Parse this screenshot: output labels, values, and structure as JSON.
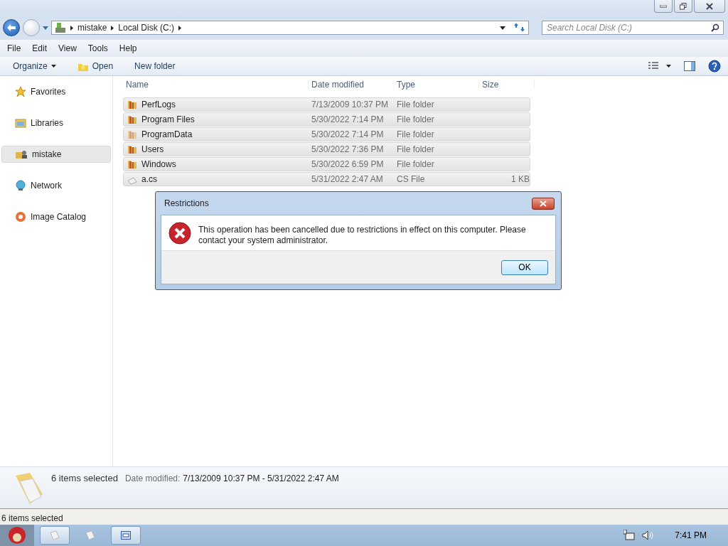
{
  "breadcrumb": [
    "mistake",
    "Local Disk (C:)"
  ],
  "search": {
    "placeholder": "Search Local Disk (C:)"
  },
  "menu": [
    "File",
    "Edit",
    "View",
    "Tools",
    "Help"
  ],
  "toolbar": {
    "organize": "Organize",
    "open": "Open",
    "new_folder": "New folder"
  },
  "sidebar": {
    "items": [
      {
        "label": "Favorites",
        "kind": "star",
        "selected": false
      },
      {
        "label": "Libraries",
        "kind": "library",
        "selected": false
      },
      {
        "label": "mistake",
        "kind": "user",
        "selected": true
      },
      {
        "label": "Network",
        "kind": "network",
        "selected": false
      },
      {
        "label": "Image Catalog",
        "kind": "catalog",
        "selected": false
      }
    ]
  },
  "table": {
    "columns": [
      "Name",
      "Date modified",
      "Type",
      "Size"
    ],
    "rows": [
      {
        "kind": "folder",
        "name": "PerfLogs",
        "date": "7/13/2009 10:37 PM",
        "type": "File folder",
        "selected": true
      },
      {
        "kind": "folder",
        "name": "Program Files",
        "date": "5/30/2022 7:14 PM",
        "type": "File folder",
        "selected": true
      },
      {
        "kind": "hidden-folder",
        "name": "ProgramData",
        "date": "5/30/2022 7:14 PM",
        "type": "File folder",
        "selected": true
      },
      {
        "kind": "folder",
        "name": "Users",
        "date": "5/30/2022 7:36 PM",
        "type": "File folder",
        "selected": true
      },
      {
        "kind": "folder",
        "name": "Windows",
        "date": "5/30/2022 6:59 PM",
        "type": "File folder",
        "selected": true
      },
      {
        "kind": "file",
        "name": "a.cs",
        "date": "5/31/2022 2:47 AM",
        "type": "CS File",
        "size": "1 KB",
        "selected": true
      }
    ]
  },
  "dialog": {
    "title": "Restrictions",
    "message": "This operation has been cancelled due to restrictions in effect on this computer. Please contact your system administrator.",
    "button": "OK"
  },
  "details": {
    "count": "6 items selected",
    "label": "Date modified:",
    "value": "7/13/2009 10:37 PM - 5/31/2022 2:47 AM"
  },
  "status_bar": "6 items selected",
  "taskbar": {
    "buttons": [
      {
        "selected": true
      },
      {
        "selected": false
      },
      {
        "selected": true
      }
    ],
    "clock": "7:41 PM"
  }
}
